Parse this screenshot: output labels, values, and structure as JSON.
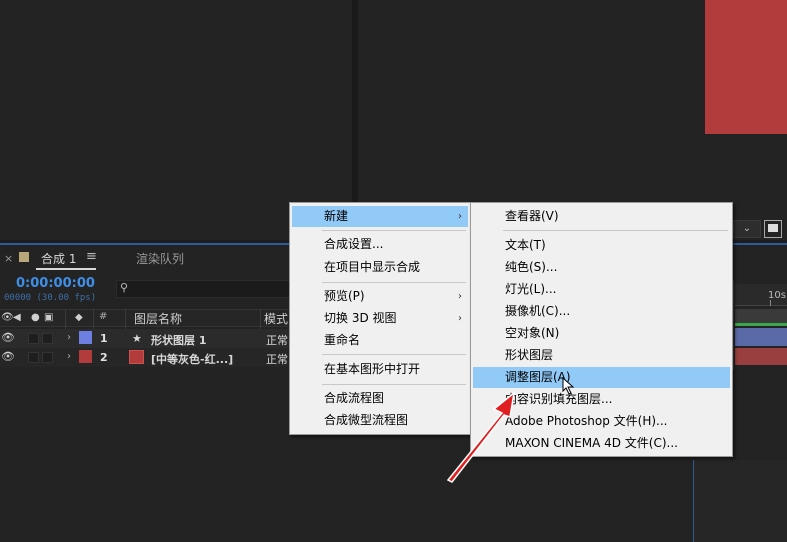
{
  "colors": {
    "accent_blue": "#3f8fe8",
    "menu_highlight": "#91c9f7",
    "layer1_label": "#6d7fe0",
    "layer2_label": "#b23b3b",
    "comp_red": "#b23b3b",
    "arrow_red": "#e02020"
  },
  "timeline": {
    "tab_close": "×",
    "comp_tab": "合成 1",
    "tab_menu": "≡",
    "render_tab": "渲染队列",
    "timecode": "0:00:00:00",
    "frames": "00000 (30.00 fps)",
    "search_icon": "search-icon",
    "header": {
      "hash": "#",
      "layer_name": "图层名称",
      "mode": "模式"
    },
    "ruler_label": "10s",
    "viewer_dropdown": "⌄",
    "layers": [
      {
        "num": "1",
        "name": "形状图层 1",
        "mode": "正常",
        "icon": "star-icon"
      },
      {
        "num": "2",
        "name": "[中等灰色-红...]",
        "mode": "正常",
        "icon": "solid-icon"
      }
    ]
  },
  "main_menu": {
    "items": [
      {
        "label": "新建",
        "submenu": true,
        "highlighted": true
      },
      {
        "label": "合成设置..."
      },
      {
        "label": "在项目中显示合成"
      },
      {
        "label": "预览(P)",
        "submenu": true
      },
      {
        "label": "切换 3D 视图",
        "submenu": true
      },
      {
        "label": "重命名"
      },
      {
        "label": "在基本图形中打开"
      },
      {
        "label": "合成流程图"
      },
      {
        "label": "合成微型流程图"
      }
    ]
  },
  "sub_menu": {
    "items": [
      {
        "label": "查看器(V)"
      },
      {
        "label": "文本(T)"
      },
      {
        "label": "纯色(S)..."
      },
      {
        "label": "灯光(L)..."
      },
      {
        "label": "摄像机(C)..."
      },
      {
        "label": "空对象(N)"
      },
      {
        "label": "形状图层"
      },
      {
        "label": "调整图层(A)",
        "highlighted": true
      },
      {
        "label": "内容识别填充图层..."
      },
      {
        "label": "Adobe Photoshop 文件(H)..."
      },
      {
        "label": "MAXON CINEMA 4D 文件(C)..."
      }
    ]
  }
}
